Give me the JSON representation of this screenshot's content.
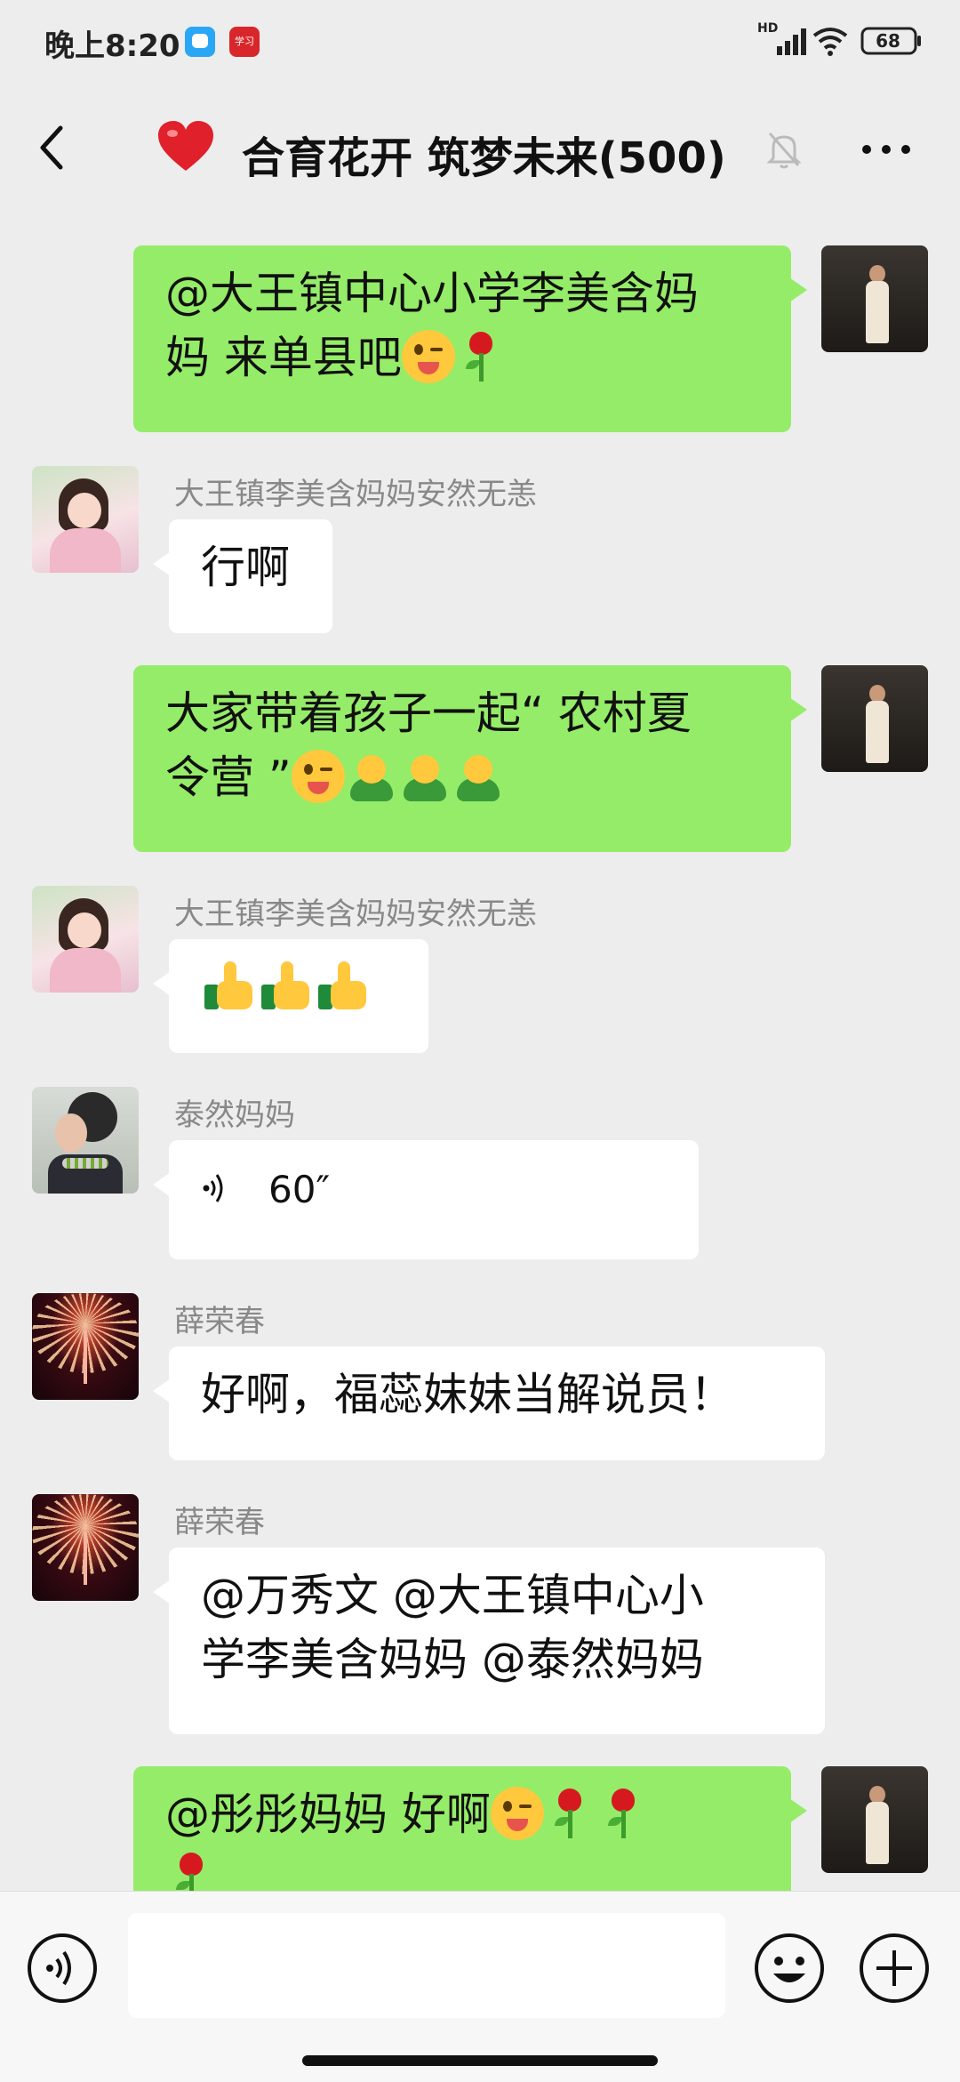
{
  "status_bar": {
    "time": "晚上8:20",
    "app2_label": "学习",
    "network_label": "HD",
    "battery": "68"
  },
  "header": {
    "title": "合育花开 筑梦未来(500)"
  },
  "messages": [
    {
      "side": "right",
      "text_a": "@大王镇中心小学李美含妈",
      "text_b": "妈  来单县吧"
    },
    {
      "side": "left",
      "sender": "大王镇李美含妈妈安然无恙",
      "text": "行啊"
    },
    {
      "side": "right",
      "text_a": "大家带着孩子一起“ 农村夏",
      "text_b": "令营 ”"
    },
    {
      "side": "left",
      "sender": "大王镇李美含妈妈安然无恙"
    },
    {
      "side": "left",
      "sender": "泰然妈妈",
      "voice_duration": "60″"
    },
    {
      "side": "left",
      "sender": "薛荣春",
      "text": "好啊，福蕊妹妹当解说员！"
    },
    {
      "side": "left",
      "sender": "薛荣春",
      "text_a": "@万秀文  @大王镇中心小",
      "text_b": "学李美含妈妈  @泰然妈妈"
    },
    {
      "side": "right",
      "text_a": "@彤彤妈妈   好啊"
    }
  ],
  "input": {
    "placeholder": ""
  },
  "colors": {
    "background": "#ededed",
    "bubble_self": "#95ec69",
    "bubble_other": "#ffffff",
    "input_bar": "#f7f7f7"
  },
  "icons": [
    "back-icon",
    "heart-icon",
    "mute-icon",
    "more-icon",
    "voice-icon",
    "emoji-icon",
    "plus-icon",
    "wink-emoji",
    "rose-emoji",
    "buddy-emoji",
    "thumbs-up-emoji"
  ]
}
